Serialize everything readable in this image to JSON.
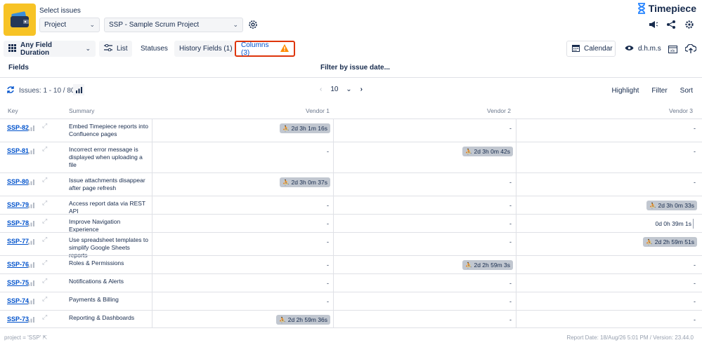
{
  "header": {
    "select_title": "Select issues",
    "project_select": "Project",
    "project_value": "SSP - Sample Scrum Project",
    "brand": "Timepiece"
  },
  "toolbar": {
    "any_field_duration": "Any Field Duration",
    "list": "List",
    "statuses": "Statuses",
    "history_fields": "History Fields (1)",
    "columns": "Columns (3)",
    "calendar": "Calendar",
    "dhms": "d.h.m.s"
  },
  "fields_bar": {
    "fields": "Fields",
    "filter_by_date": "Filter by issue date..."
  },
  "issues_bar": {
    "count": "Issues: 1 - 10 / 80",
    "page_size": "10",
    "highlight": "Highlight",
    "filter": "Filter",
    "sort": "Sort"
  },
  "table": {
    "headers": {
      "key": "Key",
      "summary": "Summary",
      "v1": "Vendor 1",
      "v2": "Vendor 2",
      "v3": "Vendor 3"
    },
    "rows": [
      {
        "key": "SSP-82",
        "summary": "Embed Timepiece reports into Confluence pages",
        "v1": "2d 3h 1m 16s",
        "v2": "-",
        "v3": "-"
      },
      {
        "key": "SSP-81",
        "summary": "Incorrect error message is displayed when uploading a file",
        "v1": "-",
        "v2": "2d 3h 0m 42s",
        "v3": "-"
      },
      {
        "key": "SSP-80",
        "summary": "Issue attachments disappear after page refresh",
        "v1": "2d 3h 0m 37s",
        "v2": "-",
        "v3": "-"
      },
      {
        "key": "SSP-79",
        "summary": "Access report data via REST API",
        "v1": "-",
        "v2": "-",
        "v3": "2d 3h 0m 33s"
      },
      {
        "key": "SSP-78",
        "summary": "Improve Navigation Experience",
        "v1": "-",
        "v2": "-",
        "v3": "0d 0h 39m 1s"
      },
      {
        "key": "SSP-77",
        "summary": "Use spreadsheet templates to simplify Google Sheets reports",
        "v1": "-",
        "v2": "-",
        "v3": "2d 2h 59m 51s"
      },
      {
        "key": "SSP-76",
        "summary": "Roles & Permissions",
        "v1": "-",
        "v2": "2d 2h 59m 3s",
        "v3": "-"
      },
      {
        "key": "SSP-75",
        "summary": "Notifications & Alerts",
        "v1": "-",
        "v2": "-",
        "v3": "-"
      },
      {
        "key": "SSP-74",
        "summary": "Payments & Billing",
        "v1": "-",
        "v2": "-",
        "v3": "-"
      },
      {
        "key": "SSP-73",
        "summary": "Reporting & Dashboards",
        "v1": "2d 2h 59m 36s",
        "v2": "-",
        "v3": "-"
      }
    ]
  },
  "footer": {
    "query": "project = 'SSP'",
    "report_date": "Report Date: 18/Aug/26 5:01 PM / Version: 23.44.0"
  },
  "colors": {
    "accent": "#0052cc",
    "warning": "#de350b",
    "logo_bg": "#f7c325",
    "pill_bg": "#c1c7d0"
  }
}
